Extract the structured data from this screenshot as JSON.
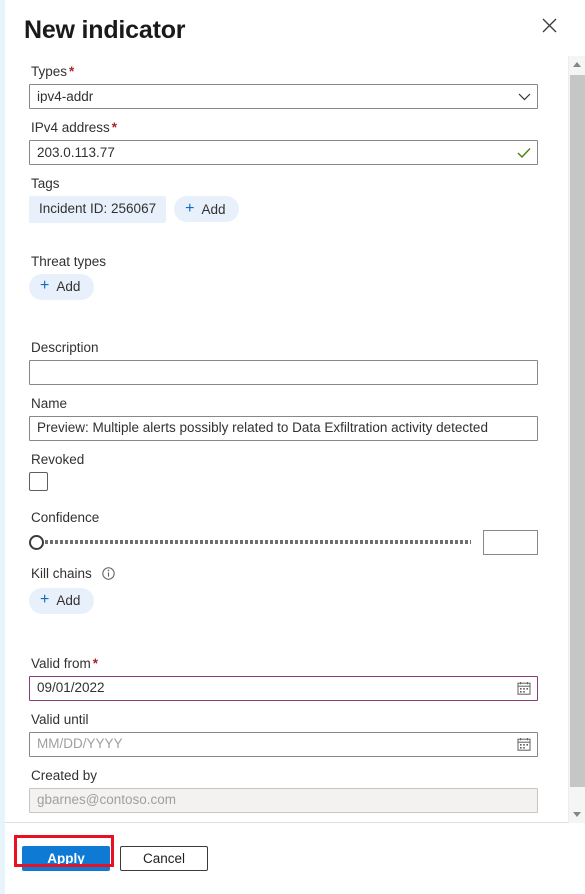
{
  "panel": {
    "title": "New indicator",
    "close_icon": "close-icon"
  },
  "fields": {
    "types": {
      "label": "Types",
      "required_marker": "*",
      "value": "ipv4-addr",
      "chevron_icon": "chevron-down-icon"
    },
    "ipv4_address": {
      "label": "IPv4 address",
      "required_marker": "*",
      "value": "203.0.113.77",
      "valid_icon": "checkmark-icon"
    },
    "tags": {
      "label": "Tags",
      "chips": [
        "Incident ID: 256067"
      ],
      "add_label": "Add",
      "add_icon": "plus-icon"
    },
    "threat_types": {
      "label": "Threat types",
      "add_label": "Add",
      "add_icon": "plus-icon"
    },
    "description": {
      "label": "Description",
      "value": "",
      "placeholder": ""
    },
    "name": {
      "label": "Name",
      "value": "Preview: Multiple alerts possibly related to Data Exfiltration activity detected"
    },
    "revoked": {
      "label": "Revoked",
      "checked": false
    },
    "confidence": {
      "label": "Confidence",
      "value": "",
      "slider_position_percent": 0
    },
    "kill_chains": {
      "label": "Kill chains",
      "info_icon": "info-icon",
      "add_label": "Add",
      "add_icon": "plus-icon"
    },
    "valid_from": {
      "label": "Valid from",
      "required_marker": "*",
      "value": "09/01/2022",
      "calendar_icon": "calendar-icon"
    },
    "valid_until": {
      "label": "Valid until",
      "value": "",
      "placeholder": "MM/DD/YYYY",
      "calendar_icon": "calendar-icon"
    },
    "created_by": {
      "label": "Created by",
      "value": "gbarnes@contoso.com"
    }
  },
  "footer": {
    "apply_label": "Apply",
    "cancel_label": "Cancel"
  },
  "scrollbar": {
    "up_icon": "scroll-up-arrow-icon",
    "down_icon": "scroll-down-arrow-icon"
  },
  "colors": {
    "primary_button": "#0f7ad4",
    "accent_border": "#8a3b7a",
    "required_marker": "#a4262c",
    "valid_check": "#498205",
    "highlight_box": "#e81123",
    "chip_background": "#e8f1fb"
  }
}
